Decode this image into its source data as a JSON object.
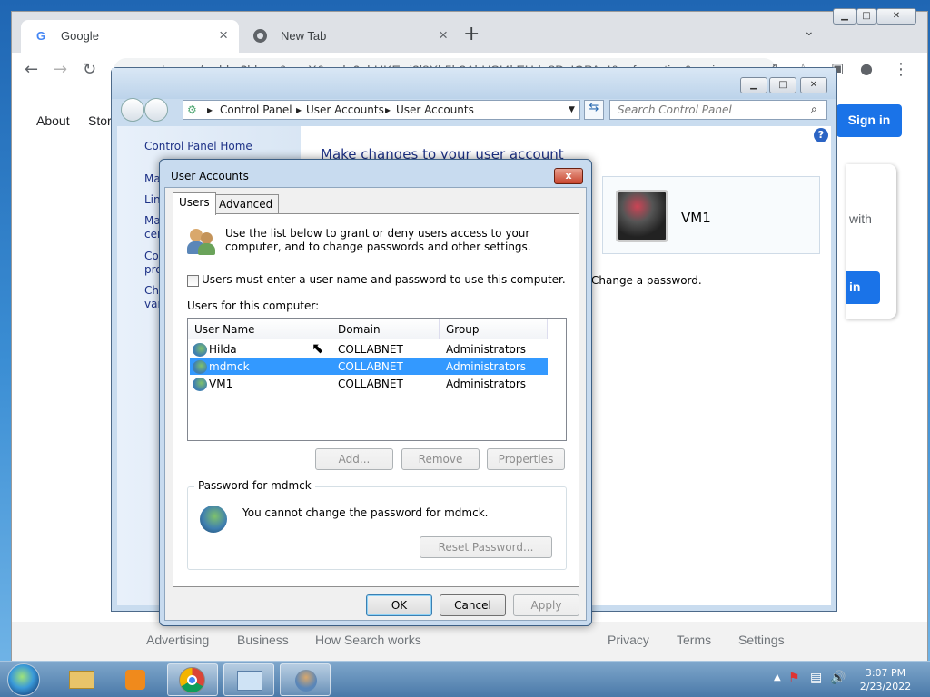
{
  "chrome": {
    "tabs": [
      {
        "label": "Google",
        "icon": "google-g-icon"
      },
      {
        "label": "New Tab",
        "icon": "chrome-icon"
      }
    ],
    "url": "google.com/webhp?hl=en&sa=X&ved=0ahUKEwi3l8Xb5b2AhUSI4kEHde8DvIQPAgI&safe=active&ssui=on"
  },
  "google": {
    "links_left": [
      "About",
      "Stor"
    ],
    "signin": "Sign in",
    "card_text": "with",
    "card_btn": "in",
    "footer": [
      "Advertising",
      "Business",
      "How Search works",
      "Privacy",
      "Terms",
      "Settings"
    ]
  },
  "control_panel": {
    "breadcrumb": [
      "Control Panel",
      "User Accounts",
      "User Accounts"
    ],
    "search_placeholder": "Search Control Panel",
    "left_home": "Control Panel Home",
    "left_items": [
      "Ma",
      "Lin",
      "Ma",
      "cer",
      "Co",
      "pro",
      "Ch",
      "var"
    ],
    "heading": "Make changes to your user account",
    "account_name": "VM1",
    "change_password": "Change a password."
  },
  "dialog": {
    "title": "User Accounts",
    "close": "x",
    "tabs": [
      "Users",
      "Advanced"
    ],
    "intro": "Use the list below to grant or deny users access to your computer, and to change passwords and other settings.",
    "checkbox_label": "Users must enter a user name and password to use this computer.",
    "list_caption": "Users for this computer:",
    "columns": [
      "User Name",
      "Domain",
      "Group"
    ],
    "rows": [
      {
        "name": "Hilda",
        "domain": "COLLABNET",
        "group": "Administrators"
      },
      {
        "name": "mdmck",
        "domain": "COLLABNET",
        "group": "Administrators"
      },
      {
        "name": "VM1",
        "domain": "COLLABNET",
        "group": "Administrators"
      }
    ],
    "buttons": {
      "add": "Add...",
      "remove": "Remove",
      "properties": "Properties"
    },
    "password_group": "Password for mdmck",
    "password_msg": "You cannot change the password for mdmck.",
    "reset": "Reset Password...",
    "ok": "OK",
    "cancel": "Cancel",
    "apply": "Apply"
  },
  "taskbar": {
    "time": "3:07 PM",
    "date": "2/23/2022"
  }
}
